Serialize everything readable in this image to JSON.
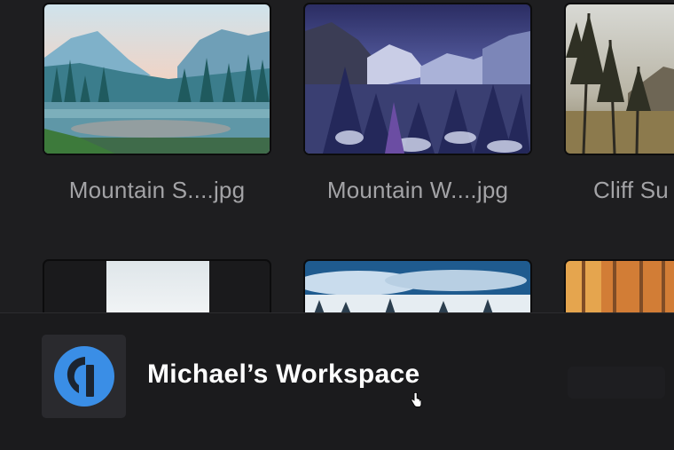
{
  "files": [
    {
      "name": "Mountain S....jpg",
      "thumbnail": "mountain-sunset"
    },
    {
      "name": "Mountain W....jpg",
      "thumbnail": "mountain-winter"
    },
    {
      "name": "Cliff Su",
      "thumbnail": "cliff-sunset"
    }
  ],
  "files_row2": [
    {
      "thumbnail": "bright-overexposed"
    },
    {
      "thumbnail": "snowy-valley"
    },
    {
      "thumbnail": "autumn-forest"
    }
  ],
  "workspace": {
    "name": "Michael’s Workspace",
    "logo_icon": "workspace-logo-icon",
    "accent": "#3a8ee6"
  },
  "colors": {
    "background": "#1e1e20",
    "filename_text": "#a3a3a6",
    "workspace_text": "#ffffff"
  }
}
